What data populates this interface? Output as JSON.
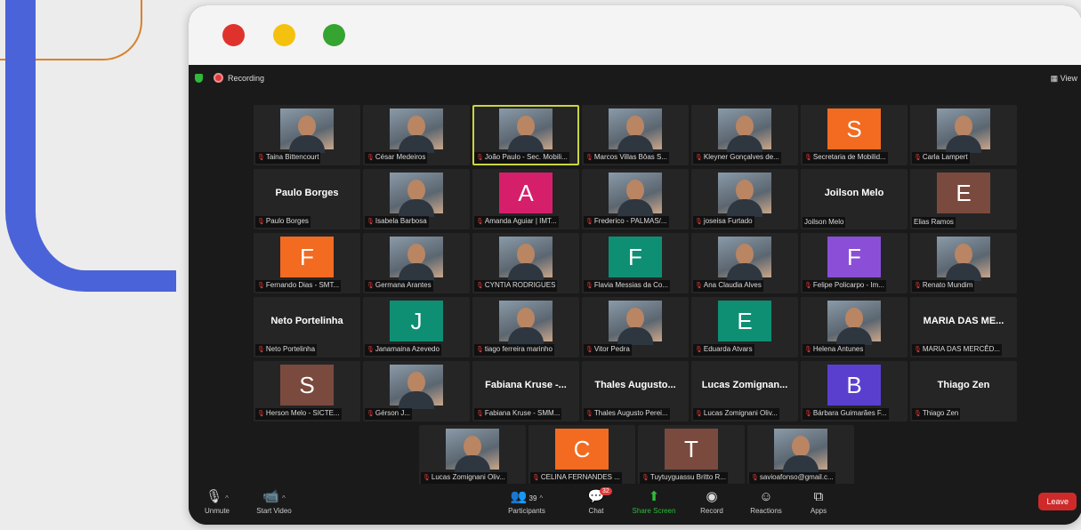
{
  "window": {
    "recording_label": "Recording",
    "view_label": "View"
  },
  "rows": [
    {
      "offset": 0,
      "tiles": [
        {
          "type": "photo",
          "name": "Taina Bittencourt"
        },
        {
          "type": "photo",
          "name": "César Medeiros"
        },
        {
          "type": "photo",
          "name": "João Paulo - Sec. Mobili...",
          "active": true
        },
        {
          "type": "photo",
          "name": "Marcos Villas Bôas S..."
        },
        {
          "type": "photo",
          "name": "Kleyner Gonçalves de..."
        },
        {
          "type": "letter",
          "letter": "S",
          "color": "#f26b21",
          "name": "Secretaria de Mobilid..."
        },
        {
          "type": "photo",
          "name": "Carla Lampert"
        }
      ]
    },
    {
      "offset": 0,
      "tiles": [
        {
          "type": "text",
          "bigname": "Paulo Borges",
          "name": "Paulo Borges"
        },
        {
          "type": "photo",
          "name": "Isabela Barbosa"
        },
        {
          "type": "letter",
          "letter": "A",
          "color": "#d61f6a",
          "name": "Amanda Aguiar | IMT..."
        },
        {
          "type": "photo",
          "name": "Frederico - PALMAS/..."
        },
        {
          "type": "photo",
          "name": "joseisa Furtado"
        },
        {
          "type": "text",
          "bigname": "Joilson Melo",
          "name": "Joilson Melo",
          "nomute": true
        },
        {
          "type": "letter",
          "letter": "E",
          "color": "#7a4a3e",
          "name": "Elias Ramos",
          "nomute": true
        }
      ]
    },
    {
      "offset": 0,
      "tiles": [
        {
          "type": "letter",
          "letter": "F",
          "color": "#f26b21",
          "name": "Fernando Dias - SMT..."
        },
        {
          "type": "photo",
          "name": "Germana Arantes"
        },
        {
          "type": "photo",
          "name": "CYNTIA RODRIGUES"
        },
        {
          "type": "letter",
          "letter": "F",
          "color": "#0e8f74",
          "name": "Flavia Messias da Co..."
        },
        {
          "type": "photo",
          "name": "Ana Claudia Alves"
        },
        {
          "type": "letter",
          "letter": "F",
          "color": "#8a4fd6",
          "name": "Felipe Policarpo - Im..."
        },
        {
          "type": "photo",
          "name": "Renato Mundim"
        }
      ]
    },
    {
      "offset": 0,
      "tiles": [
        {
          "type": "text",
          "bigname": "Neto Portelinha",
          "name": "Neto Portelinha"
        },
        {
          "type": "letter",
          "letter": "J",
          "color": "#0e8f74",
          "name": "Janamaina Azevedo"
        },
        {
          "type": "photo",
          "name": "tiago ferreira marinho"
        },
        {
          "type": "photo",
          "name": "Vitor Pedra"
        },
        {
          "type": "letter",
          "letter": "E",
          "color": "#0e8f74",
          "name": "Eduarda Atvars"
        },
        {
          "type": "photo",
          "name": "Helena Antunes"
        },
        {
          "type": "text",
          "bigname": "MARIA DAS ME...",
          "name": "MARIA DAS MERCÊD..."
        }
      ]
    },
    {
      "offset": 0,
      "tiles": [
        {
          "type": "letter",
          "letter": "S",
          "color": "#7a4a3e",
          "name": "Herson Melo - SICTE..."
        },
        {
          "type": "photo",
          "name": "Gérson J..."
        },
        {
          "type": "text",
          "bigname": "Fabiana Kruse -...",
          "name": "Fabiana Kruse - SMM..."
        },
        {
          "type": "text",
          "bigname": "Thales Augusto...",
          "name": "Thales Augusto Perei..."
        },
        {
          "type": "text",
          "bigname": "Lucas Zomignan...",
          "name": "Lucas Zomignani Oliv..."
        },
        {
          "type": "letter",
          "letter": "B",
          "color": "#5a3fcf",
          "name": "Bárbara Guimarães F..."
        },
        {
          "type": "text",
          "bigname": "Thiago Zen",
          "name": "Thiago Zen"
        }
      ]
    },
    {
      "offset": 1,
      "tiles": [
        {
          "type": "photo",
          "name": "Lucas Zomignani Oliv..."
        },
        {
          "type": "letter",
          "letter": "C",
          "color": "#f26b21",
          "name": "CELINA FERNANDES ..."
        },
        {
          "type": "letter",
          "letter": "T",
          "color": "#7a4a3e",
          "name": "Tuytuyguassu Britto R..."
        },
        {
          "type": "photo",
          "name": "savioafonso@gmail.c..."
        }
      ]
    }
  ],
  "toolbar": {
    "unmute": "Unmute",
    "start_video": "Start Video",
    "participants": "Participants",
    "participants_count": "39",
    "chat": "Chat",
    "chat_badge": "32",
    "share_screen": "Share Screen",
    "record": "Record",
    "reactions": "Reactions",
    "apps": "Apps",
    "leave": "Leave"
  }
}
